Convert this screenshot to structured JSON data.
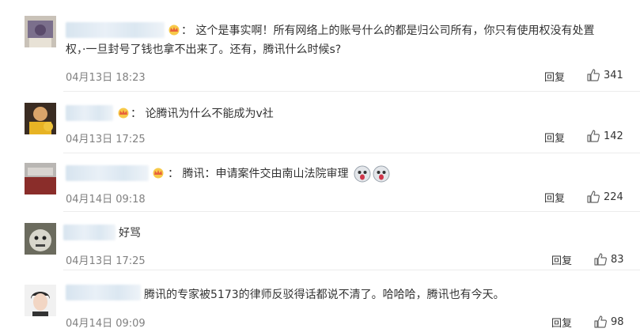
{
  "comments": [
    {
      "text_line1": "这个是事实啊！所有网络上的账号什么的都是归公司所有，你只有使用权没有处置",
      "text_line2_a": "权，·",
      "text_line2_b": "一旦封号了钱也拿不出来了。还有，腾讯什么时候s?",
      "time": "04月13日 18:23",
      "reply": "回复",
      "likes": "341"
    },
    {
      "text_line1": "论腾讯为什么不能成为v社",
      "time": "04月13日 17:25",
      "reply": "回复",
      "likes": "142"
    },
    {
      "text_line1": "腾讯：申请案件交由南山法院审理",
      "time": "04月14日 09:18",
      "reply": "回复",
      "likes": "224"
    },
    {
      "text_line1": "好骂",
      "time": "04月13日 17:25",
      "reply": "回复",
      "likes": "83"
    },
    {
      "text_line1": "腾讯的专家被5173的律师反驳得话都说不清了。哈哈哈，腾讯也有今天。",
      "time": "04月14日 09:09",
      "reply": "回复",
      "likes": "98"
    }
  ],
  "colors": {
    "text": "#333333",
    "meta": "#808080",
    "divider": "#ececec",
    "crown": "#f5a623"
  },
  "icons": {
    "like": "thumbs-up-icon",
    "vip": "crown-icon",
    "emoji": "doge-emoji-icon"
  }
}
